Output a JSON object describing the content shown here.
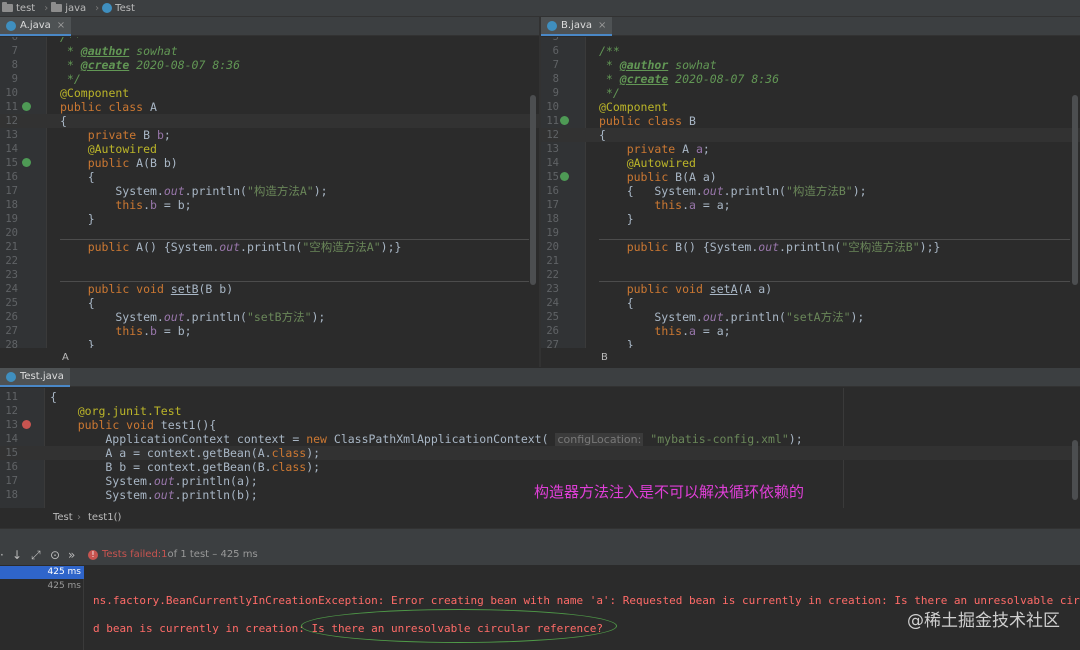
{
  "breadcrumb": {
    "project": "test",
    "folder": "java",
    "file": "Test"
  },
  "editorA": {
    "tab": "A.java",
    "footer": "A",
    "lines": [
      {
        "n": "6",
        "html": "<span class='cm'>/**</span>"
      },
      {
        "n": "7",
        "html": "<span class='cm'> * </span><span class='tag'>@author</span><span class='cm'> sowhat</span>"
      },
      {
        "n": "8",
        "html": "<span class='cm'> * </span><span class='tag'>@create</span><span class='cm'> 2020-08-07 8:36</span>"
      },
      {
        "n": "9",
        "html": "<span class='cm'> */</span>"
      },
      {
        "n": "10",
        "html": "<span class='ann'>@Component</span>"
      },
      {
        "n": "11",
        "html": "<span class='kw'>public class </span>A"
      },
      {
        "n": "12",
        "html": "{"
      },
      {
        "n": "13",
        "html": "    <span class='kw'>private </span>B <span class='fld'>b</span>;"
      },
      {
        "n": "14",
        "html": "    <span class='ann'>@Autowired</span>"
      },
      {
        "n": "15",
        "html": "    <span class='kw'>public </span>A(B b)"
      },
      {
        "n": "16",
        "html": "    {"
      },
      {
        "n": "17",
        "html": "        System.<span class='ital'>out</span>.println(<span class='str'>\"构造方法A\"</span>);"
      },
      {
        "n": "18",
        "html": "        <span class='kw'>this</span>.<span class='fld'>b</span> = b;"
      },
      {
        "n": "19",
        "html": "    }"
      },
      {
        "n": "20",
        "html": ""
      },
      {
        "n": "21",
        "html": "    <span class='kw'>public </span>A() {System.<span class='ital'>out</span>.println(<span class='str'>\"空构造方法A\"</span>);}"
      },
      {
        "n": "22",
        "html": ""
      },
      {
        "n": "23",
        "html": ""
      },
      {
        "n": "24",
        "html": "    <span class='kw'>public void </span><span class='ul'>setB</span>(B b)"
      },
      {
        "n": "25",
        "html": "    {"
      },
      {
        "n": "26",
        "html": "        System.<span class='ital'>out</span>.println(<span class='str'>\"setB方法\"</span>);"
      },
      {
        "n": "27",
        "html": "        <span class='kw'>this</span>.<span class='fld'>b</span> = b;"
      },
      {
        "n": "28",
        "html": "    }"
      }
    ]
  },
  "editorB": {
    "tab": "B.java",
    "footer": "B",
    "lines": [
      {
        "n": "5",
        "html": ""
      },
      {
        "n": "6",
        "html": "<span class='cm'>/**</span>"
      },
      {
        "n": "7",
        "html": "<span class='cm'> * </span><span class='tag'>@author</span><span class='cm'> sowhat</span>"
      },
      {
        "n": "8",
        "html": "<span class='cm'> * </span><span class='tag'>@create</span><span class='cm'> 2020-08-07 8:36</span>"
      },
      {
        "n": "9",
        "html": "<span class='cm'> */</span>"
      },
      {
        "n": "10",
        "html": "<span class='ann'>@Component</span>"
      },
      {
        "n": "11",
        "html": "<span class='kw'>public class </span>B"
      },
      {
        "n": "12",
        "html": "{"
      },
      {
        "n": "13",
        "html": "    <span class='kw'>private </span>A <span class='fld'>a</span>;"
      },
      {
        "n": "14",
        "html": "    <span class='ann'>@Autowired</span>"
      },
      {
        "n": "15",
        "html": "    <span class='kw'>public </span>B(A a)"
      },
      {
        "n": "16",
        "html": "    {   System.<span class='ital'>out</span>.println(<span class='str'>\"构造方法B\"</span>);"
      },
      {
        "n": "17",
        "html": "        <span class='kw'>this</span>.<span class='fld'>a</span> = a;"
      },
      {
        "n": "18",
        "html": "    }"
      },
      {
        "n": "19",
        "html": ""
      },
      {
        "n": "20",
        "html": "    <span class='kw'>public </span>B() {System.<span class='ital'>out</span>.println(<span class='str'>\"空构造方法B\"</span>);}"
      },
      {
        "n": "21",
        "html": ""
      },
      {
        "n": "22",
        "html": ""
      },
      {
        "n": "23",
        "html": "    <span class='kw'>public void </span><span class='ul'>setA</span>(A a)"
      },
      {
        "n": "24",
        "html": "    {"
      },
      {
        "n": "25",
        "html": "        System.<span class='ital'>out</span>.println(<span class='str'>\"setA方法\"</span>);"
      },
      {
        "n": "26",
        "html": "        <span class='kw'>this</span>.<span class='fld'>a</span> = a;"
      },
      {
        "n": "27",
        "html": "    }"
      }
    ]
  },
  "editorTest": {
    "tab": "Test.java",
    "footer": {
      "cls": "Test",
      "method": "test1()"
    },
    "lines": [
      {
        "n": "11",
        "html": "{"
      },
      {
        "n": "12",
        "html": "    <span class='ann'>@org.junit.Test</span>"
      },
      {
        "n": "13",
        "html": "    <span class='kw'>public void </span>test1(){"
      },
      {
        "n": "14",
        "html": "        ApplicationContext context = <span class='kw'>new </span>ClassPathXmlApplicationContext( <span class='hint'>configLocation:</span> <span class='str'>\"mybatis-config.xml\"</span>);"
      },
      {
        "n": "15",
        "html": "        A a = context.getBean(A.<span class='kw'>class</span>);"
      },
      {
        "n": "16",
        "html": "        B b = context.getBean(B.<span class='kw'>class</span>);"
      },
      {
        "n": "17",
        "html": "        System.<span class='ital'>out</span>.println(a);"
      },
      {
        "n": "18",
        "html": "        System.<span class='ital'>out</span>.println(b);"
      }
    ],
    "note": "构造器方法注入是不可以解决循环依赖的"
  },
  "run": {
    "status_failed": "Tests failed: ",
    "status_count": "1",
    "status_rest": " of 1 test – 425 ms",
    "tree": [
      "425 ms",
      "425 ms"
    ],
    "console": [
      "ns.factory.BeanCurrentlyInCreationException: Error creating bean with name 'a': Requested bean is currently in creation: Is there an unresolvable circ",
      "d bean is currently in creation: Is there an unresolvable circular reference?"
    ],
    "watermark": "@稀土掘金技术社区"
  }
}
